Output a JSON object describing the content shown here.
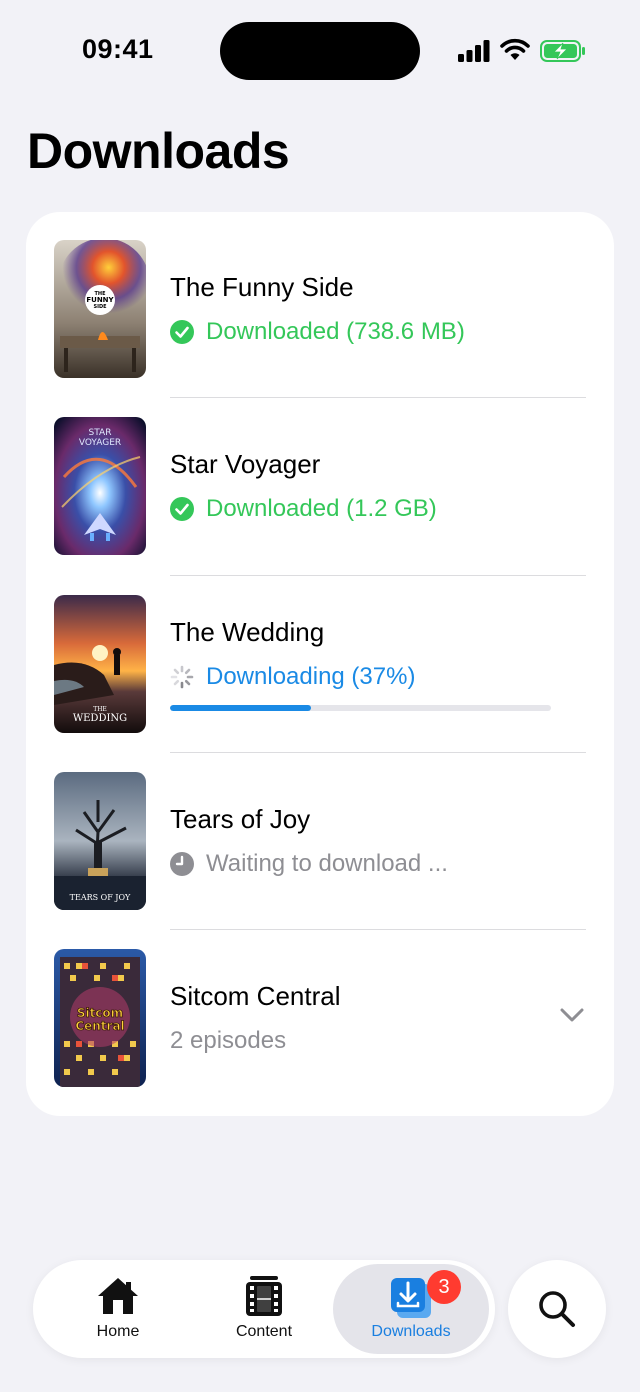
{
  "status_bar": {
    "time": "09:41"
  },
  "page": {
    "title": "Downloads"
  },
  "downloads": [
    {
      "title": "The Funny Side",
      "status": "Downloaded (738.6 MB)",
      "state": "downloaded",
      "poster_text": [
        "THE",
        "FUNNY",
        "SIDE"
      ]
    },
    {
      "title": "Star Voyager",
      "status": "Downloaded (1.2 GB)",
      "state": "downloaded",
      "poster_text": [
        "STAR",
        "VOYAGER"
      ]
    },
    {
      "title": "The Wedding",
      "status": "Downloading (37%)",
      "state": "downloading",
      "progress": 0.37,
      "poster_text": [
        "THE",
        "WEDDING"
      ]
    },
    {
      "title": "Tears of Joy",
      "status": "Waiting to download ...",
      "state": "waiting",
      "poster_text": [
        "TEARS OF JOY"
      ]
    },
    {
      "title": "Sitcom Central",
      "status": "2 episodes",
      "state": "series",
      "poster_text": [
        "Sitcom",
        "Central"
      ]
    }
  ],
  "tab_bar": {
    "tabs": [
      {
        "label": "Home",
        "icon": "house-icon"
      },
      {
        "label": "Content",
        "icon": "film-icon"
      },
      {
        "label": "Downloads",
        "icon": "download-tray-icon",
        "badge": "3",
        "active": true
      }
    ],
    "search_icon": "magnifier-icon"
  },
  "colors": {
    "accent": "#1a8ae5",
    "success": "#34c759",
    "badge": "#ff3b30",
    "secondary_text": "#8e8e93"
  }
}
